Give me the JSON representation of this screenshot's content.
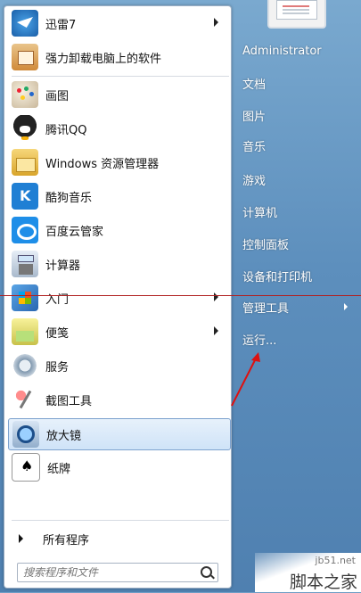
{
  "start_menu": {
    "pinned_items": [
      {
        "label": "迅雷7",
        "icon": "xunlei-icon",
        "has_submenu": true
      },
      {
        "label": "强力卸载电脑上的软件",
        "icon": "uninstall-icon",
        "has_submenu": false
      }
    ],
    "recent_items": [
      {
        "label": "画图",
        "icon": "paint-icon",
        "has_submenu": false
      },
      {
        "label": "腾讯QQ",
        "icon": "qq-icon",
        "has_submenu": false
      },
      {
        "label": "Windows 资源管理器",
        "icon": "explorer-icon",
        "has_submenu": false
      },
      {
        "label": "酷狗音乐",
        "icon": "kugou-icon",
        "has_submenu": false
      },
      {
        "label": "百度云管家",
        "icon": "baidu-cloud-icon",
        "has_submenu": false
      },
      {
        "label": "计算器",
        "icon": "calculator-icon",
        "has_submenu": false
      },
      {
        "label": "入门",
        "icon": "getting-started-icon",
        "has_submenu": true
      },
      {
        "label": "便笺",
        "icon": "sticky-notes-icon",
        "has_submenu": true
      },
      {
        "label": "服务",
        "icon": "services-icon",
        "has_submenu": false
      },
      {
        "label": "截图工具",
        "icon": "snipping-tool-icon",
        "has_submenu": false
      },
      {
        "label": "放大镜",
        "icon": "magnifier-icon",
        "has_submenu": false,
        "selected": true
      },
      {
        "label": "纸牌",
        "icon": "solitaire-icon",
        "has_submenu": false
      }
    ],
    "all_programs_label": "所有程序",
    "search_placeholder": "搜索程序和文件",
    "right_links": [
      {
        "label": "Administrator"
      },
      {
        "label": "文档"
      },
      {
        "label": "图片"
      },
      {
        "label": "音乐"
      },
      {
        "label": "游戏"
      },
      {
        "label": "计算机"
      },
      {
        "label": "控制面板"
      },
      {
        "label": "设备和打印机"
      },
      {
        "label": "管理工具",
        "has_submenu": true
      },
      {
        "label": "运行..."
      }
    ]
  },
  "watermark": {
    "site": "jb51.net",
    "text": "脚本之家"
  },
  "colors": {
    "accent_line": "#b02020",
    "selection": "#cfe3f8",
    "right_panel": "#5d8fbd"
  }
}
